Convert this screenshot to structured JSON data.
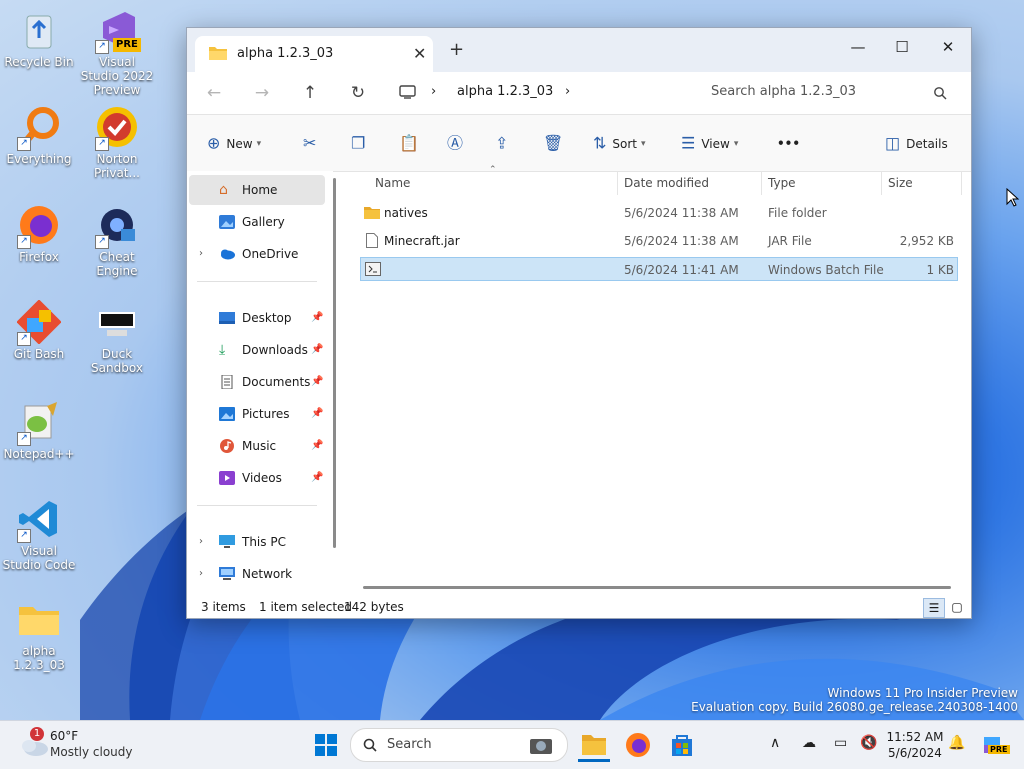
{
  "desktop": {
    "icons": [
      {
        "label": "Recycle Bin"
      },
      {
        "label": "Visual Studio 2022 Preview",
        "badge": "PRE"
      },
      {
        "label": "Everything"
      },
      {
        "label": "Norton Privat..."
      },
      {
        "label": "Firefox"
      },
      {
        "label": "Cheat Engine"
      },
      {
        "label": "Git Bash"
      },
      {
        "label": "Duck Sandbox"
      },
      {
        "label": "Notepad++"
      },
      {
        "label": "Visual Studio Code"
      },
      {
        "label": "alpha 1.2.3_03"
      }
    ],
    "watermark_line1": "Windows 11 Pro Insider Preview",
    "watermark_line2": "Evaluation copy. Build 26080.ge_release.240308-1400"
  },
  "window": {
    "tab_title": "alpha 1.2.3_03",
    "tab_close": "✕",
    "new_tab": "+",
    "minimize": "—",
    "maximize": "☐",
    "close": "✕",
    "breadcrumb": [
      "alpha 1.2.3_03"
    ],
    "search_placeholder": "Search alpha 1.2.3_03",
    "commands": {
      "new": "New",
      "sort": "Sort",
      "view": "View",
      "more": "•••",
      "details": "Details"
    },
    "sidebar": {
      "home": "Home",
      "gallery": "Gallery",
      "onedrive": "OneDrive",
      "desktop": "Desktop",
      "downloads": "Downloads",
      "documents": "Documents",
      "pictures": "Pictures",
      "music": "Music",
      "videos": "Videos",
      "thispc": "This PC",
      "network": "Network"
    },
    "columns": {
      "name": "Name",
      "date": "Date modified",
      "type": "Type",
      "size": "Size"
    },
    "files": [
      {
        "name": "natives",
        "date": "5/6/2024 11:38 AM",
        "type": "File folder",
        "size": ""
      },
      {
        "name": "Minecraft.jar",
        "date": "5/6/2024 11:38 AM",
        "type": "JAR File",
        "size": "2,952 KB"
      },
      {
        "name": "",
        "date": "5/6/2024 11:41 AM",
        "type": "Windows Batch File",
        "size": "1 KB"
      }
    ],
    "status": {
      "count": "3 items",
      "selected": "1 item selected",
      "size": "142 bytes"
    }
  },
  "taskbar": {
    "weather_badge": "1",
    "temperature": "60°F",
    "condition": "Mostly cloudy",
    "search_label": "Search",
    "time": "11:52 AM",
    "date": "5/6/2024",
    "copilot_badge": "PRE"
  },
  "colors": {
    "accent": "#0067c0",
    "selection": "#cce4f7",
    "folder": "#f5c23e"
  }
}
